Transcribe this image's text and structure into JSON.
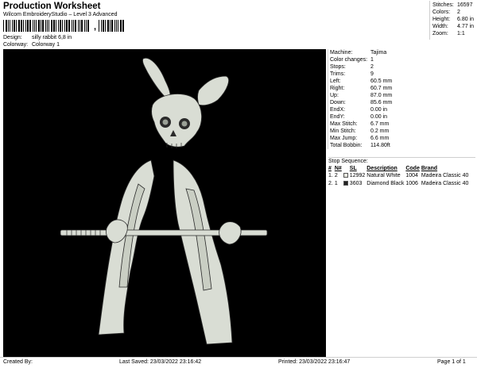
{
  "header": {
    "title": "Production Worksheet",
    "subtitle": "Wilcom EmbroideryStudio – Level 3 Advanced",
    "barcode_suffix": ","
  },
  "design": {
    "design_label": "Design:",
    "design_value": "silly rabbit 6,8 in",
    "colorway_label": "Colorway:",
    "colorway_value": "Colorway 1"
  },
  "stats": [
    {
      "label": "Stitches:",
      "value": "16597"
    },
    {
      "label": "Colors:",
      "value": "2"
    },
    {
      "label": "Height:",
      "value": "6.80 in"
    },
    {
      "label": "Width:",
      "value": "4.77 in"
    },
    {
      "label": "Zoom:",
      "value": "1:1"
    }
  ],
  "machine": [
    {
      "label": "Machine:",
      "value": "Tajima"
    },
    {
      "label": "Color changes:",
      "value": "1"
    },
    {
      "label": "Stops:",
      "value": "2"
    },
    {
      "label": "Trims:",
      "value": "9"
    },
    {
      "label": "Left:",
      "value": "60.5 mm"
    },
    {
      "label": "Right:",
      "value": "60.7 mm"
    },
    {
      "label": "Up:",
      "value": "87.0 mm"
    },
    {
      "label": "Down:",
      "value": "85.6 mm"
    },
    {
      "label": "EndX:",
      "value": "0.00 in"
    },
    {
      "label": "EndY:",
      "value": "0.00 in"
    },
    {
      "label": "Max Stitch:",
      "value": "6.7 mm"
    },
    {
      "label": "Min Stitch:",
      "value": "0.2 mm"
    },
    {
      "label": "Max Jump:",
      "value": "6.6 mm"
    },
    {
      "label": "Total Bobbin:",
      "value": "114.80ft"
    }
  ],
  "sequence": {
    "title": "Stop Sequence:",
    "headers": [
      "#",
      "N#",
      "",
      "SL",
      "Description",
      "Code",
      "Brand"
    ],
    "rows": [
      {
        "num": "1.",
        "n": "2",
        "color": "#e8e8e0",
        "sl": "12992",
        "desc": "Natural White",
        "code": "1004",
        "brand": "Madeira Classic 40"
      },
      {
        "num": "2.",
        "n": "1",
        "color": "#222222",
        "sl": "3603",
        "desc": "Diamond Black",
        "code": "1006",
        "brand": "Madeira Classic 40"
      }
    ]
  },
  "footer": {
    "created": "Created By:",
    "saved": "Last Saved: 23/03/2022 23:16:42",
    "printed": "Printed: 23/03/2022 23:16:47",
    "page": "Page 1 of 1"
  },
  "colors": {
    "canvas": "#000000",
    "stitch": "#d9ddd4",
    "stitch_dark": "#9aa096"
  }
}
